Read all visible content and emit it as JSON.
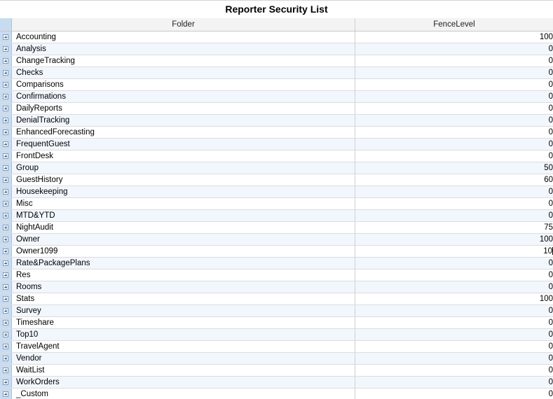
{
  "title": "Reporter Security List",
  "columns": {
    "folder": "Folder",
    "fence": "FenceLevel"
  },
  "rows": [
    {
      "folder": "Accounting",
      "fence": "100"
    },
    {
      "folder": "Analysis",
      "fence": "0"
    },
    {
      "folder": "ChangeTracking",
      "fence": "0"
    },
    {
      "folder": "Checks",
      "fence": "0"
    },
    {
      "folder": "Comparisons",
      "fence": "0"
    },
    {
      "folder": "Confirmations",
      "fence": "0"
    },
    {
      "folder": "DailyReports",
      "fence": "0"
    },
    {
      "folder": "DenialTracking",
      "fence": "0"
    },
    {
      "folder": "EnhancedForecasting",
      "fence": "0"
    },
    {
      "folder": "FrequentGuest",
      "fence": "0"
    },
    {
      "folder": "FrontDesk",
      "fence": "0"
    },
    {
      "folder": "Group",
      "fence": "50"
    },
    {
      "folder": "GuestHistory",
      "fence": "60"
    },
    {
      "folder": "Housekeeping",
      "fence": "0"
    },
    {
      "folder": "Misc",
      "fence": "0"
    },
    {
      "folder": "MTD&YTD",
      "fence": "0"
    },
    {
      "folder": "NightAudit",
      "fence": "75"
    },
    {
      "folder": "Owner",
      "fence": "100"
    },
    {
      "folder": "Owner1099",
      "fence": "10"
    },
    {
      "folder": "Rate&PackagePlans",
      "fence": "0"
    },
    {
      "folder": "Res",
      "fence": "0"
    },
    {
      "folder": "Rooms",
      "fence": "0"
    },
    {
      "folder": "Stats",
      "fence": "100"
    },
    {
      "folder": "Survey",
      "fence": "0"
    },
    {
      "folder": "Timeshare",
      "fence": "0"
    },
    {
      "folder": "Top10",
      "fence": "0"
    },
    {
      "folder": "TravelAgent",
      "fence": "0"
    },
    {
      "folder": "Vendor",
      "fence": "0"
    },
    {
      "folder": "WaitList",
      "fence": "0"
    },
    {
      "folder": "WorkOrders",
      "fence": "0"
    },
    {
      "folder": "_Custom",
      "fence": "0"
    }
  ],
  "editing_row_index": 18
}
